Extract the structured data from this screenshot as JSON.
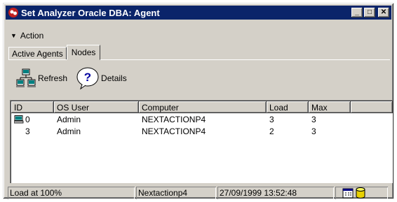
{
  "window": {
    "title": "Set Analyzer Oracle DBA: Agent"
  },
  "titlebar_buttons": {
    "minimize": "_",
    "maximize": "□",
    "close": "✕"
  },
  "menu": {
    "action_label": "Action"
  },
  "tabs": [
    {
      "label": "Active Agents",
      "active": false
    },
    {
      "label": "Nodes",
      "active": true
    }
  ],
  "toolbar": {
    "refresh_label": "Refresh",
    "details_label": "Details"
  },
  "table": {
    "columns": [
      "ID",
      "OS User",
      "Computer",
      "Load",
      "Max"
    ],
    "rows": [
      {
        "id": "0",
        "os_user": "Admin",
        "computer": "NEXTACTIONP4",
        "load": "3",
        "max": "3",
        "icon": "computer-icon"
      },
      {
        "id": "3",
        "os_user": "Admin",
        "computer": "NEXTACTIONP4",
        "load": "2",
        "max": "3",
        "icon": ""
      }
    ]
  },
  "status": {
    "load": "Load at 100%",
    "node": "Nextactionp4",
    "datetime": "27/09/1999 13:52:48",
    "icons": [
      "calendar-icon",
      "database-icon"
    ]
  },
  "colors": {
    "titlebar": "#0a246a",
    "face": "#d4d0c8"
  }
}
